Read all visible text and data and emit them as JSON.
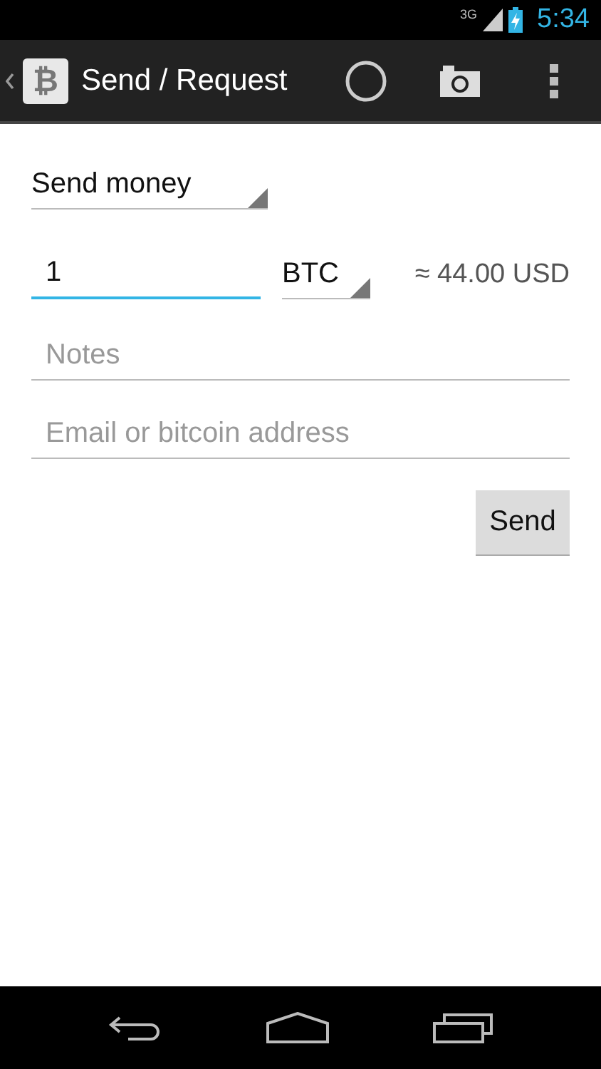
{
  "status_bar": {
    "network": "3G",
    "time": "5:34"
  },
  "action_bar": {
    "app_icon": "₿",
    "title": "Send / Request"
  },
  "mode_spinner": {
    "value": "Send money"
  },
  "amount": {
    "value": "1",
    "focused": true
  },
  "currency_spinner": {
    "value": "BTC"
  },
  "conversion": "≈ 44.00 USD",
  "fields": [
    {
      "placeholder": "Notes",
      "focused": false
    },
    {
      "placeholder": "Email or bitcoin address",
      "focused": false
    }
  ],
  "send_button": "Send"
}
